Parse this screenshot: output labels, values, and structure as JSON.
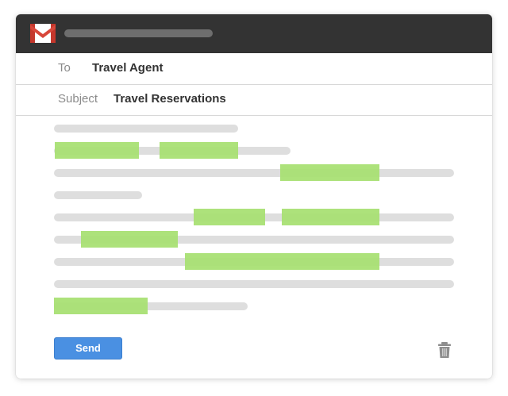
{
  "window": {
    "title_icon": "gmail-icon"
  },
  "compose": {
    "to_label": "To",
    "to_value": "Travel Agent",
    "subject_label": "Subject",
    "subject_value": "Travel Reservations"
  },
  "actions": {
    "send_label": "Send",
    "delete_icon": "trash-icon"
  },
  "colors": {
    "titlebar": "#333333",
    "send_button": "#4a90e2",
    "highlight": "#a6e070",
    "placeholder_line": "#dedede"
  }
}
